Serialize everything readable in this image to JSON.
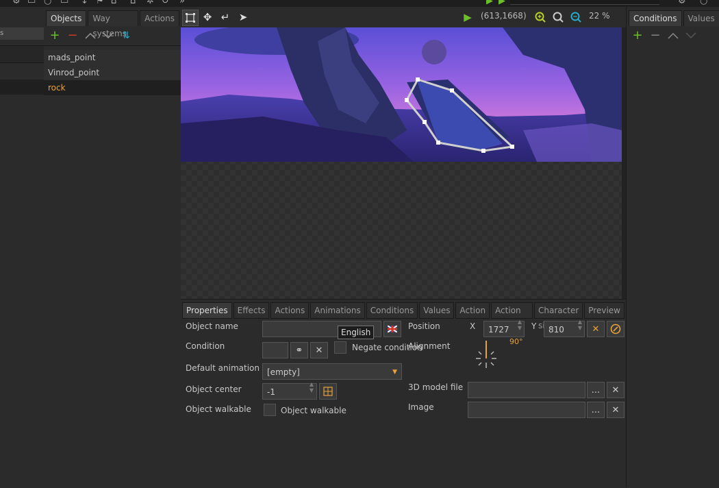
{
  "objects_panel": {
    "tabs": [
      "Objects",
      "Way systems",
      "Actions"
    ],
    "items": [
      "mads_point",
      "Vinrod_point",
      "rock"
    ],
    "selected_index": 2
  },
  "leftcol": {
    "label": "s"
  },
  "canvas_toolbar": {
    "coords": "(613,1668)",
    "zoom": "22 %"
  },
  "right_panel": {
    "tabs": [
      "Conditions",
      "Values"
    ]
  },
  "properties": {
    "tabs": [
      "Properties",
      "Effects",
      "Actions",
      "Animations",
      "Conditions",
      "Values",
      "Action",
      "Action areas",
      "Character size",
      "Preview"
    ],
    "object_name_label": "Object name",
    "tooltip": "English",
    "condition_label": "Condition",
    "negate_label": "Negate condition",
    "default_anim_label": "Default animation",
    "default_anim_value": "[empty]",
    "object_center_label": "Object center",
    "object_center_value": "-1",
    "object_walkable_label": "Object walkable",
    "object_walkable_check_label": "Object walkable",
    "position_label": "Position",
    "x_label": "X",
    "x_value": "1727",
    "y_label": "Y",
    "y_value": "810",
    "alignment_label": "Alignment",
    "angle_value": "90°",
    "model_label": "3D model file",
    "image_label": "Image",
    "ellipsis": "..."
  },
  "colors": {
    "accent_orange": "#e8a33a",
    "green": "#6abf2a",
    "red": "#d03a2a",
    "cyan": "#2aa8c8"
  }
}
